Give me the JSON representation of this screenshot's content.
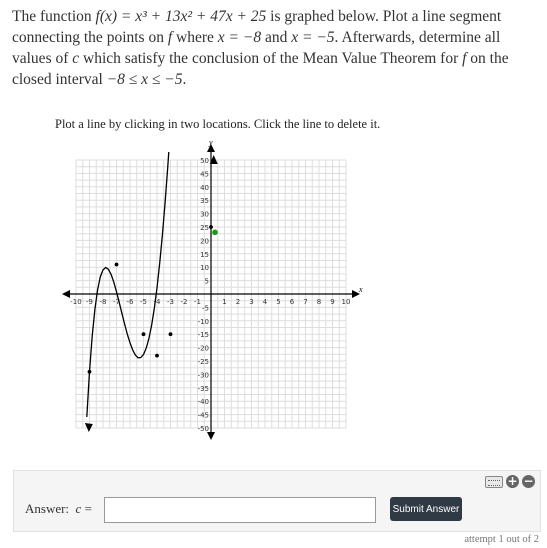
{
  "problem": {
    "text_1": "The function",
    "func": "f(x) = x³ + 13x² + 47x + 25",
    "text_2": "is graphed below. Plot a line segment connecting the points on",
    "f_letter": "f",
    "text_3": "where",
    "x_eq_1": "x = −8",
    "text_and": "and",
    "x_eq_2": "x = −5",
    "text_4": ". Afterwards, determine all values of",
    "c_letter": "c",
    "text_5": "which satisfy the conclusion of the Mean Value Theorem for",
    "text_6": "on the closed interval",
    "interval": "−8 ≤ x ≤ −5",
    "period": "."
  },
  "instruction": "Plot a line by clicking in two locations. Click the line to delete it.",
  "chart_data": {
    "type": "line",
    "xlabel": "x",
    "ylabel": "y",
    "xlim": [
      -10,
      10
    ],
    "ylim": [
      -50,
      50
    ],
    "grid": true,
    "x_ticks": [
      -10,
      -9,
      -8,
      -7,
      -6,
      -5,
      -4,
      -3,
      -2,
      -1,
      1,
      2,
      3,
      4,
      5,
      6,
      7,
      8,
      9,
      10
    ],
    "y_ticks": [
      -50,
      -45,
      -40,
      -35,
      -30,
      -25,
      -20,
      -15,
      -10,
      -5,
      5,
      10,
      15,
      20,
      25,
      30,
      35,
      40,
      45,
      50
    ],
    "x": [
      -9.2,
      -9.0,
      -8.8,
      -8.6,
      -8.4,
      -8.2,
      -8.0,
      -7.8,
      -7.6,
      -7.4,
      -7.2,
      -7.0,
      -6.8,
      -6.6,
      -6.4,
      -6.2,
      -6.0,
      -5.8,
      -5.6,
      -5.4,
      -5.2,
      -5.0,
      -4.8,
      -4.6,
      -4.4,
      -4.2,
      -4.0,
      -3.8,
      -3.6,
      -3.4,
      -3.2,
      -3.0,
      -2.8,
      -2.6,
      -2.4,
      -2.2,
      -2.0,
      -1.8,
      -1.6,
      -1.4,
      -1.2,
      -1.0,
      -0.8,
      -0.6,
      -0.4,
      -0.2,
      0.0,
      0.2,
      0.4,
      0.6,
      0.8,
      1.0
    ],
    "y": [
      -45.9,
      -29.0,
      -15.7,
      -5.7,
      1.6,
      6.4,
      9.0,
      9.9,
      9.2,
      7.3,
      4.4,
      0.8,
      -3.1,
      -7.2,
      -11.2,
      -15.0,
      -18.2,
      -20.9,
      -22.8,
      -23.8,
      -23.7,
      -22.6,
      -20.2,
      -16.6,
      -11.7,
      -5.4,
      2.3,
      11.5,
      22.1,
      34.1,
      47.6,
      62.5,
      78.8,
      96.4,
      115.5,
      135.9,
      157.6,
      180.6,
      204.8,
      230.3,
      257.0,
      284.9,
      313.9,
      344.0,
      375.2,
      407.4,
      440.6,
      474.8,
      509.9,
      545.9,
      582.8,
      620.5
    ],
    "points": [
      {
        "x": -9,
        "y": -29
      },
      {
        "x": -7,
        "y": 11
      },
      {
        "x": -5,
        "y": -15
      },
      {
        "x": -4,
        "y": -23
      },
      {
        "x": -3,
        "y": -15
      },
      {
        "x": 0,
        "y": 25
      }
    ],
    "highlight_point": {
      "x": 0,
      "y": 23
    }
  },
  "answer": {
    "label": "Answer:",
    "var": "c",
    "equals": "=",
    "value": "",
    "submit_label": "Submit Answer"
  },
  "attempt": "attempt 1 out of 2",
  "colors": {
    "curve": "#000000",
    "highlight": "#1a9a1a",
    "grid": "#dddddd",
    "button": "#2f3a45"
  },
  "icons": [
    "keyboard-icon",
    "plus-icon",
    "minus-icon"
  ]
}
